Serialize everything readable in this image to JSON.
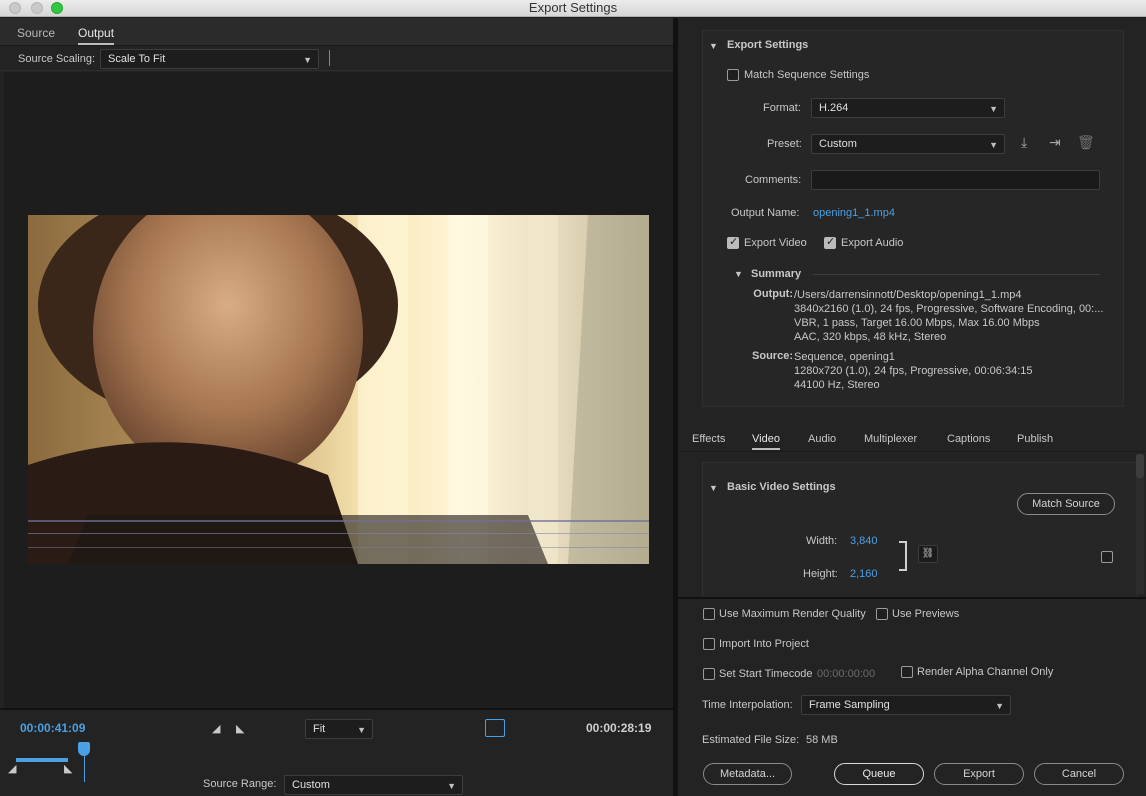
{
  "window": {
    "title": "Export Settings"
  },
  "left": {
    "tabs": [
      {
        "label": "Source"
      },
      {
        "label": "Output"
      }
    ],
    "scaling": {
      "label": "Source Scaling:",
      "value": "Scale To Fit"
    },
    "timeline": {
      "current_tc": "00:00:41:09",
      "duration_tc": "00:00:28:19",
      "zoom": "Fit",
      "source_range_label": "Source Range:",
      "source_range_value": "Custom"
    }
  },
  "right": {
    "export_settings": {
      "title": "Export Settings",
      "match_sequence": "Match Sequence Settings",
      "format_label": "Format:",
      "format_value": "H.264",
      "preset_label": "Preset:",
      "preset_value": "Custom",
      "comments_label": "Comments:",
      "output_name_label": "Output Name:",
      "output_name_value": "opening1_1.mp4",
      "export_video": "Export Video",
      "export_audio": "Export Audio",
      "summary_title": "Summary",
      "summary_output_key": "Output:",
      "summary_output_lines": [
        "/Users/darrensinnott/Desktop/opening1_1.mp4",
        "3840x2160 (1.0), 24 fps, Progressive, Software Encoding, 00:...",
        "VBR, 1 pass, Target 16.00 Mbps, Max 16.00 Mbps",
        "AAC, 320 kbps, 48 kHz, Stereo"
      ],
      "summary_source_key": "Source:",
      "summary_source_lines": [
        "Sequence, opening1",
        "1280x720 (1.0), 24 fps, Progressive, 00:06:34:15",
        "44100 Hz, Stereo"
      ]
    },
    "tabs": [
      {
        "label": "Effects"
      },
      {
        "label": "Video"
      },
      {
        "label": "Audio"
      },
      {
        "label": "Multiplexer"
      },
      {
        "label": "Captions"
      },
      {
        "label": "Publish"
      }
    ],
    "basic_video": {
      "title": "Basic Video Settings",
      "match_source": "Match Source",
      "width_label": "Width:",
      "width_value": "3,840",
      "height_label": "Height:",
      "height_value": "2,160"
    },
    "bottom": {
      "max_render": "Use Maximum Render Quality",
      "use_previews": "Use Previews",
      "import_project": "Import Into Project",
      "start_tc": "Set Start Timecode",
      "start_tc_value": "00:00:00:00",
      "alpha_only": "Render Alpha Channel Only",
      "interp_label": "Time Interpolation:",
      "interp_value": "Frame Sampling",
      "file_size_label": "Estimated File Size:",
      "file_size_value": "58 MB",
      "metadata_btn": "Metadata...",
      "queue_btn": "Queue",
      "export_btn": "Export",
      "cancel_btn": "Cancel"
    }
  }
}
